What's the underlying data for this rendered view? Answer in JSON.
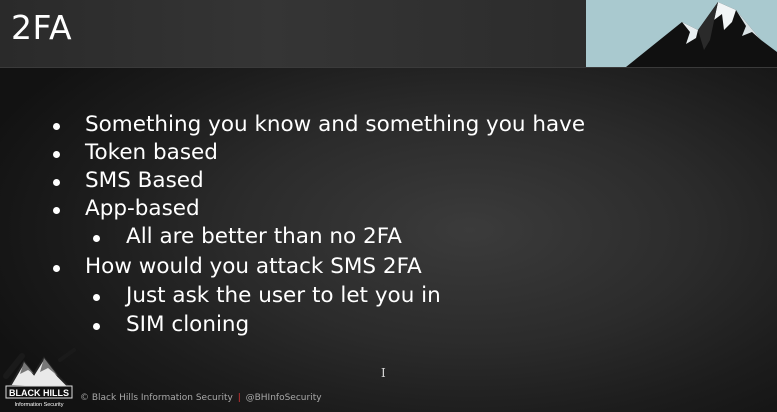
{
  "slide": {
    "title": "2FA",
    "bullets": [
      {
        "level": 1,
        "text": "Something you know and something you have"
      },
      {
        "level": 1,
        "text": "Token based"
      },
      {
        "level": 1,
        "text": "SMS Based"
      },
      {
        "level": 1,
        "text": "App-based"
      },
      {
        "level": 2,
        "text": "All are better than no 2FA"
      },
      {
        "level": 1,
        "text": "How would you attack SMS 2FA"
      },
      {
        "level": 2,
        "text": "Just ask the user to let you in"
      },
      {
        "level": 2,
        "text": "SIM cloning"
      }
    ]
  },
  "footer": {
    "copyright": "© Black Hills Information Security",
    "separator": "|",
    "handle": "@BHInfoSecurity"
  },
  "logo": {
    "line1": "BLACK HILLS",
    "line2": "Information Security"
  },
  "cursor_glyph": "I"
}
